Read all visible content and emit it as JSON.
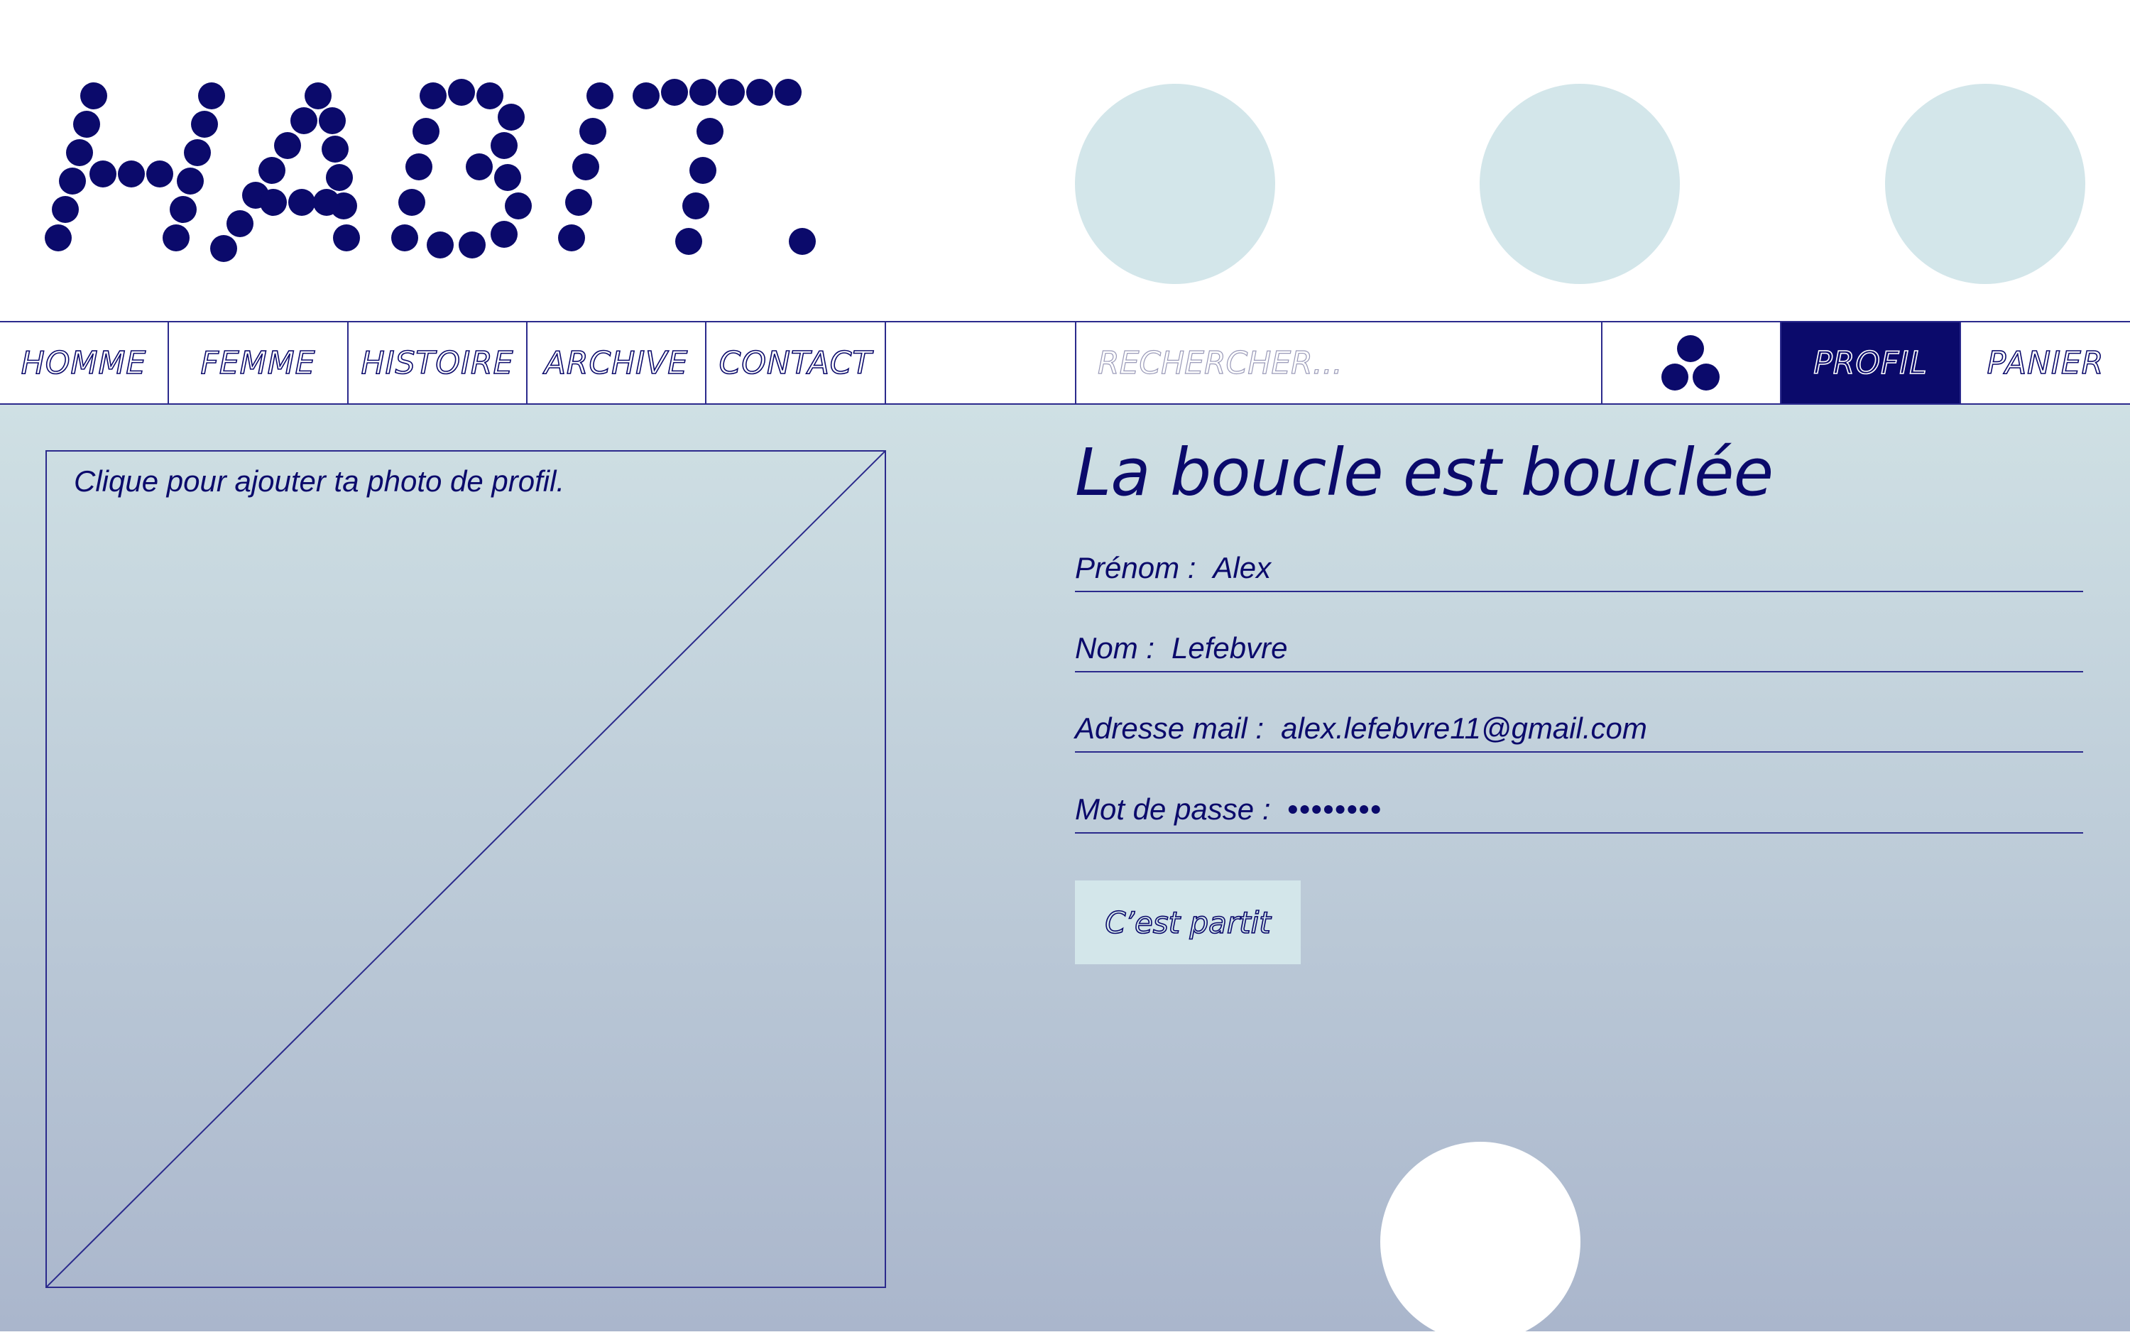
{
  "brand": {
    "logo_text": "HABIT."
  },
  "colors": {
    "primary": "#0b0a6b",
    "accent_light": "#d3e6ea",
    "background_top": "#cfe0e4",
    "background_bottom": "#aab6cc"
  },
  "nav": {
    "items": [
      {
        "label": "HOMME"
      },
      {
        "label": "FEMME"
      },
      {
        "label": "HISTOIRE"
      },
      {
        "label": "ARCHIVE"
      },
      {
        "label": "CONTACT"
      }
    ],
    "search_placeholder": "RECHERCHER...",
    "cluster_icon": "three-dots-cluster-icon",
    "profile_label": "PROFIL",
    "cart_label": "PANIER"
  },
  "profile_photo": {
    "hint": "Clique pour ajouter ta photo de profil."
  },
  "form": {
    "title": "La boucle est bouclée",
    "fields": [
      {
        "label": "Prénom :",
        "value": "Alex"
      },
      {
        "label": "Nom :",
        "value": "Lefebvre"
      },
      {
        "label": "Adresse mail :",
        "value": "alex.lefebvre11@gmail.com"
      },
      {
        "label": "Mot de passe :",
        "value": "••••••••"
      }
    ],
    "submit_label": "C’est partit"
  }
}
